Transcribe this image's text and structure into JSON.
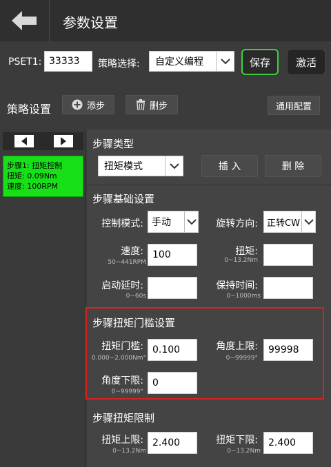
{
  "header": {
    "title": "参数设置"
  },
  "topbar": {
    "pset_label": "PSET1:",
    "pset_value": "33333",
    "strategy_label": "策略选择:",
    "strategy_value": "自定义编程",
    "save_label": "保存",
    "activate_label": "激活"
  },
  "strategy_row": {
    "title": "策略设置",
    "add_step": "添步",
    "delete_step": "删步",
    "general_config": "通用配置"
  },
  "left_panel": {
    "steps": [
      {
        "line1": "步骤1: 扭矩控制",
        "line2": "扭矩: 0.09Nm",
        "line3": "速度: 100RPM"
      }
    ]
  },
  "step_type": {
    "title": "步骤类型",
    "mode_value": "扭矩模式",
    "insert_label": "插 入",
    "delete_label": "删 除"
  },
  "basic": {
    "title": "步骤基础设置",
    "control_mode_label": "控制模式:",
    "control_mode_value": "手动",
    "rotation_label": "旋转方向:",
    "rotation_value": "正转CW",
    "speed_label": "速度:",
    "speed_range": "50~441RPM",
    "speed_value": "100",
    "torque_label": "扭矩:",
    "torque_range": "0~13.2Nm",
    "torque_value": "",
    "start_delay_label": "启动延时:",
    "start_delay_range": "0~60s",
    "start_delay_value": "",
    "hold_time_label": "保持时间:",
    "hold_time_range": "0~1000ms",
    "hold_time_value": ""
  },
  "threshold": {
    "title": "步骤扭矩门槛设置",
    "torque_threshold_label": "扭矩门槛:",
    "torque_threshold_range": "0.000~2.000Nm°",
    "torque_threshold_value": "0.100",
    "angle_upper_label": "角度上限:",
    "angle_upper_range": "0~99999°",
    "angle_upper_value": "99998",
    "angle_lower_label": "角度下限:",
    "angle_lower_range": "0~99999°",
    "angle_lower_value": "0"
  },
  "limit": {
    "title": "步骤扭矩限制",
    "upper_label": "扭矩上限:",
    "upper_range": "0~13.2Nm",
    "upper_value": "2.400",
    "lower_label": "扭矩下限:",
    "lower_range": "0~13.2Nm",
    "lower_value": "2.400"
  },
  "colors": {
    "save_border": "#3fd03f",
    "step_card_bg": "#18e018",
    "highlight_border": "#d32424"
  },
  "icons": [
    "back-arrow-icon",
    "chevron-down-icon",
    "plus-circle-icon",
    "trash-icon",
    "triangle-left-icon",
    "triangle-right-icon"
  ]
}
